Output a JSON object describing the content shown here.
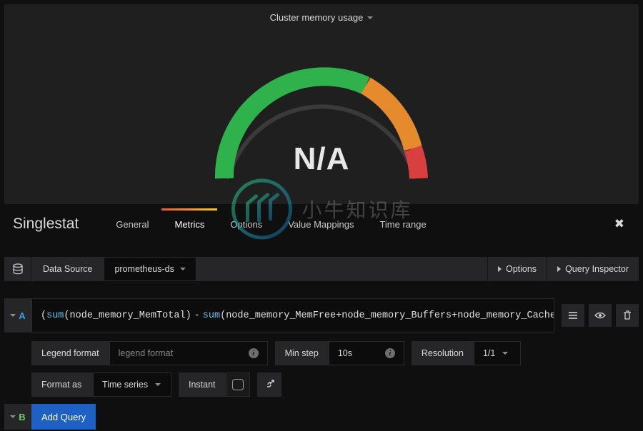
{
  "panel": {
    "title": "Cluster memory usage",
    "value": "N/A"
  },
  "watermark": "小牛知识库",
  "editor": {
    "type_title": "Singlestat",
    "tabs": [
      "General",
      "Metrics",
      "Options",
      "Value Mappings",
      "Time range"
    ],
    "active_tab": "Metrics"
  },
  "data_source": {
    "label": "Data Source",
    "selected": "prometheus-ds",
    "options_btn": "Options",
    "inspector_btn": "Query Inspector"
  },
  "query_a": {
    "letter": "A",
    "expr_tokens": [
      {
        "t": "p",
        "v": "("
      },
      {
        "t": "kw",
        "v": "sum"
      },
      {
        "t": "p",
        "v": "("
      },
      {
        "t": "met",
        "v": "node_memory_MemTotal"
      },
      {
        "t": "p",
        "v": ")"
      },
      {
        "t": "op",
        "v": "-"
      },
      {
        "t": "kw",
        "v": "sum"
      },
      {
        "t": "p",
        "v": "("
      },
      {
        "t": "met",
        "v": "node_memory_MemFree+node_memory_Buffers+node_memory_Cached"
      },
      {
        "t": "p",
        "v": ")"
      }
    ],
    "legend_label": "Legend format",
    "legend_placeholder": "legend format",
    "minstep_label": "Min step",
    "minstep_value": "10s",
    "resolution_label": "Resolution",
    "resolution_value": "1/1",
    "format_label": "Format as",
    "format_value": "Time series",
    "instant_label": "Instant"
  },
  "query_b": {
    "letter": "B",
    "add_label": "Add Query"
  }
}
